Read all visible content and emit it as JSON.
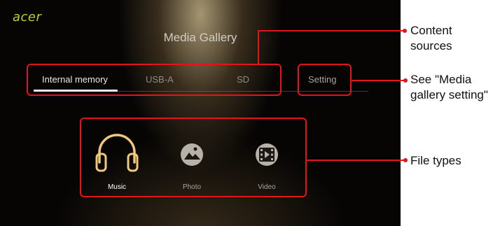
{
  "screen": {
    "logo": "acer",
    "title": "Media Gallery",
    "tabs": [
      {
        "label": "Internal memory",
        "active": true
      },
      {
        "label": "USB-A",
        "active": false
      },
      {
        "label": "SD",
        "active": false
      }
    ],
    "setting_label": "Setting",
    "file_types": [
      {
        "label": "Music",
        "icon": "headphones-icon",
        "active": true
      },
      {
        "label": "Photo",
        "icon": "photo-icon",
        "active": false
      },
      {
        "label": "Video",
        "icon": "film-icon",
        "active": false
      }
    ]
  },
  "callouts": {
    "content_sources": "Content sources",
    "media_gallery_setting": "See \"Media gallery setting\"",
    "file_types": "File types"
  },
  "colors": {
    "accent_gold": "#f0c878",
    "callout_red": "#e0161c",
    "logo_green": "#b9cf2e"
  }
}
